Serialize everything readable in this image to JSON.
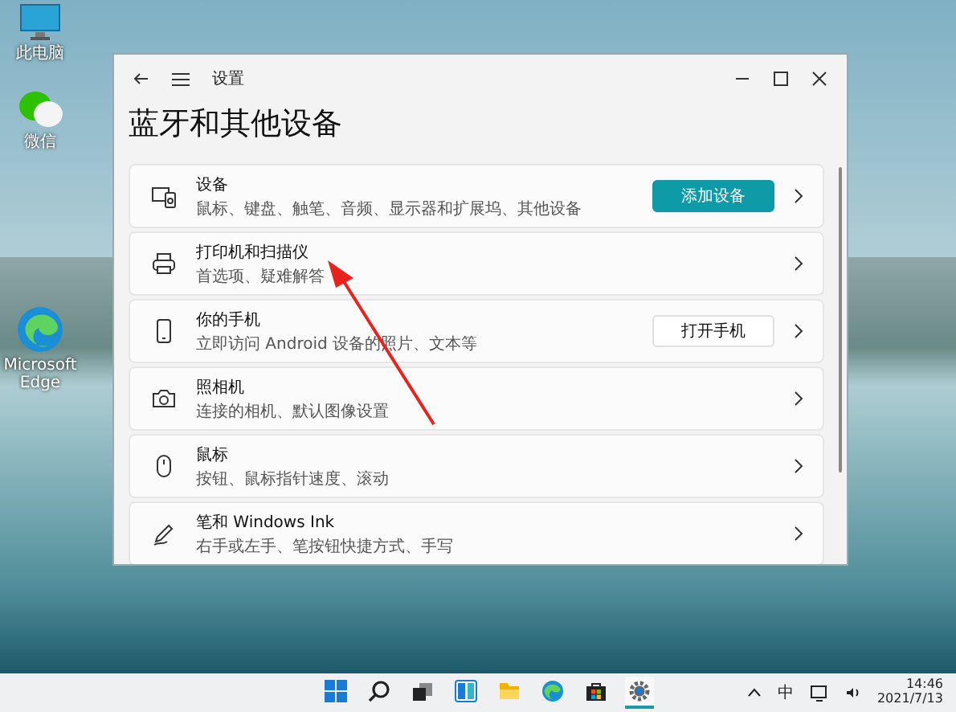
{
  "desktop_icons": [
    {
      "kind": "computer",
      "label": "此电脑"
    },
    {
      "kind": "chat",
      "label": "微信"
    },
    {
      "kind": "edge",
      "label": "Microsoft Edge"
    }
  ],
  "window": {
    "title": "设置",
    "heading": "蓝牙和其他设备",
    "rows": [
      {
        "kind": "devices",
        "title": "设备",
        "subtitle": "鼠标、键盘、触笔、音频、显示器和扩展坞、其他设备",
        "button": {
          "label": "添加设备",
          "kind": "primary"
        }
      },
      {
        "kind": "printer",
        "title": "打印机和扫描仪",
        "subtitle": "首选项、疑难解答"
      },
      {
        "kind": "phone",
        "title": "你的手机",
        "subtitle": "立即访问 Android 设备的照片、文本等",
        "button": {
          "label": "打开手机",
          "kind": "secondary"
        }
      },
      {
        "kind": "camera",
        "title": "照相机",
        "subtitle": "连接的相机、默认图像设置"
      },
      {
        "kind": "mouse",
        "title": "鼠标",
        "subtitle": "按钮、鼠标指针速度、滚动"
      },
      {
        "kind": "pen",
        "title": "笔和 Windows Ink",
        "subtitle": "右手或左手、笔按钮快捷方式、手写"
      }
    ]
  },
  "taskbar": {
    "apps": [
      {
        "kind": "start",
        "active": false
      },
      {
        "kind": "search",
        "active": false
      },
      {
        "kind": "taskview",
        "active": false
      },
      {
        "kind": "widgets",
        "active": false
      },
      {
        "kind": "explorer",
        "active": false
      },
      {
        "kind": "edge",
        "active": false
      },
      {
        "kind": "store",
        "active": false
      },
      {
        "kind": "settings",
        "active": true
      }
    ],
    "ime": "中",
    "time": "14:46",
    "date": "2021/7/13"
  }
}
